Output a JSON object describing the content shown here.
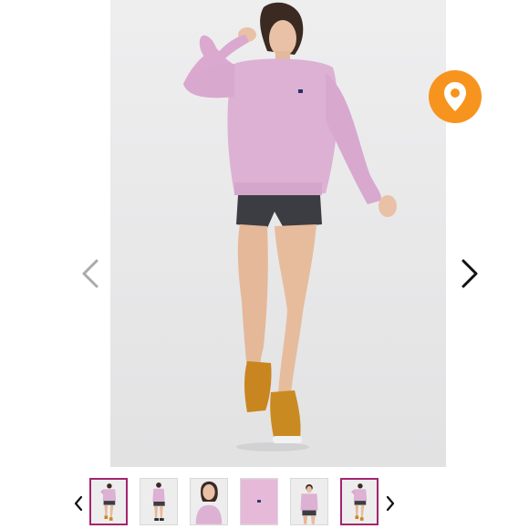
{
  "gallery": {
    "main_image_name": "pink-sweatshirt-model",
    "prev_icon": "chevron-left-icon",
    "next_icon": "chevron-right-icon",
    "location_icon": "map-pin-icon",
    "location_color": "#f7941d",
    "arrow_light_color": "#aaaaaa",
    "arrow_dark_color": "#111111"
  },
  "thumbnails": {
    "selected_border_color": "#a2256f",
    "prev_icon": "chevron-left-icon",
    "next_icon": "chevron-right-icon",
    "items": [
      {
        "view": "full-front",
        "selected": true
      },
      {
        "view": "full-side",
        "selected": false
      },
      {
        "view": "upper-body",
        "selected": false
      },
      {
        "view": "fabric-detail",
        "selected": false
      },
      {
        "view": "full-front-close",
        "selected": false
      },
      {
        "view": "full-front",
        "selected": true
      }
    ]
  }
}
